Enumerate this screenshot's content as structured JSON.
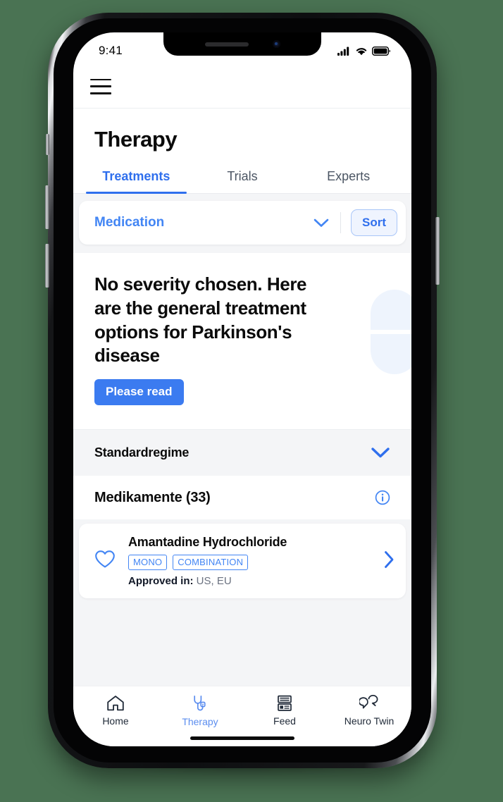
{
  "status_bar": {
    "time": "9:41",
    "icons": [
      "cellular-signal-icon",
      "wifi-icon",
      "battery-icon"
    ]
  },
  "top_bar": {
    "menu_icon": "hamburger-menu-icon"
  },
  "header": {
    "title": "Therapy"
  },
  "tabs": [
    {
      "label": "Treatments",
      "active": true
    },
    {
      "label": "Trials",
      "active": false
    },
    {
      "label": "Experts",
      "active": false
    }
  ],
  "filter_bar": {
    "selected": "Medication",
    "dropdown_icon": "chevron-down-icon",
    "sort_label": "Sort"
  },
  "hero": {
    "title": "No severity chosen. Here are the general treatment options for Parkinson's disease",
    "cta_label": "Please read",
    "illustration": "capsule-pill-icon"
  },
  "section": {
    "title": "Standardregime",
    "toggle_icon": "chevron-down-icon"
  },
  "subsection": {
    "title": "Medikamente (33)",
    "info_icon": "info-circle-icon"
  },
  "medications": [
    {
      "name": "Amantadine Hydrochloride",
      "badges": [
        "MONO",
        "COMBINATION"
      ],
      "approved_label": "Approved in:",
      "approved_value": "US, EU",
      "favorite_icon": "heart-outline-icon",
      "chevron_icon": "chevron-right-icon"
    }
  ],
  "bottom_nav": [
    {
      "label": "Home",
      "icon": "home-icon",
      "active": false
    },
    {
      "label": "Therapy",
      "icon": "stethoscope-icon",
      "active": true
    },
    {
      "label": "Feed",
      "icon": "feed-articles-icon",
      "active": false
    },
    {
      "label": "Neuro Twin",
      "icon": "chat-bubbles-icon",
      "active": false
    }
  ],
  "colors": {
    "accent_blue": "#2f6fed",
    "link_blue": "#4285f4",
    "cta_blue": "#3b7bf0",
    "capsule_blue": "#eef4fd",
    "surface_gray": "#f4f5f7",
    "page_background": "#4a7353"
  }
}
